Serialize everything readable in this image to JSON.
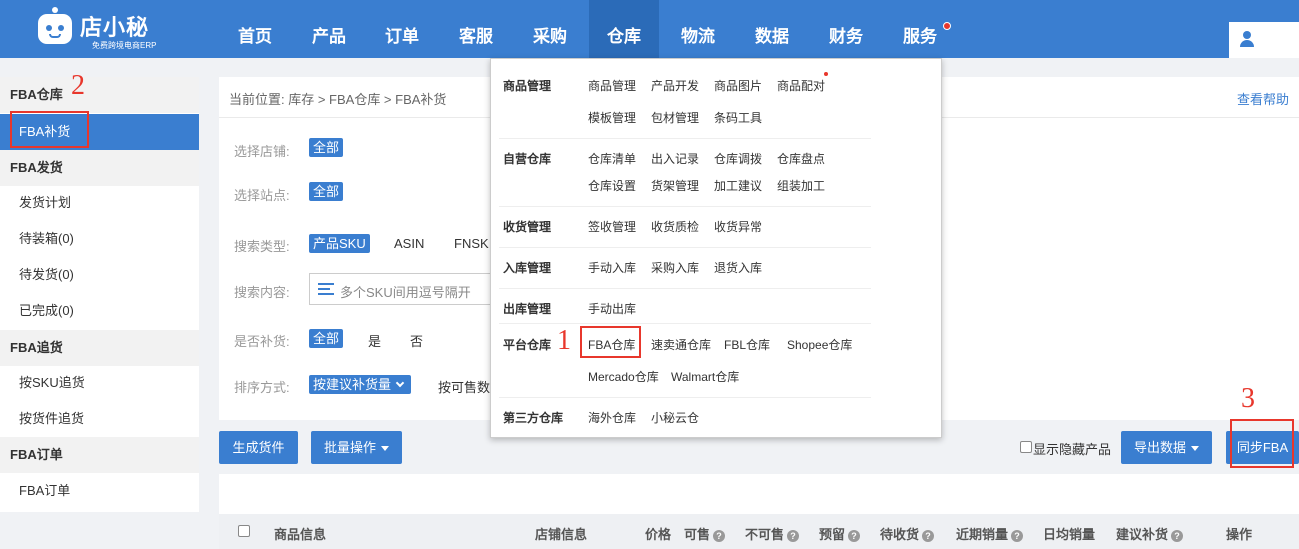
{
  "logo": {
    "title": "店小秘",
    "subtitle": "免费跨境电商ERP"
  },
  "nav": {
    "items": [
      {
        "label": "首页"
      },
      {
        "label": "产品"
      },
      {
        "label": "订单"
      },
      {
        "label": "客服"
      },
      {
        "label": "采购"
      },
      {
        "label": "仓库"
      },
      {
        "label": "物流"
      },
      {
        "label": "数据"
      },
      {
        "label": "财务"
      },
      {
        "label": "服务"
      }
    ],
    "active": "仓库"
  },
  "sidebar": {
    "groups": [
      {
        "label": "FBA仓库",
        "items": [
          {
            "label": "FBA补货"
          }
        ]
      },
      {
        "label": "FBA发货",
        "items": [
          {
            "label": "发货计划"
          },
          {
            "label": "待装箱(0)"
          },
          {
            "label": "待发货(0)"
          },
          {
            "label": "已完成(0)"
          }
        ]
      },
      {
        "label": "FBA追货",
        "items": [
          {
            "label": "按SKU追货"
          },
          {
            "label": "按货件追货"
          }
        ]
      },
      {
        "label": "FBA订单",
        "items": [
          {
            "label": "FBA订单"
          }
        ]
      }
    ],
    "active": "FBA补货"
  },
  "breadcrumb": "当前位置:  库存 > FBA仓库 > FBA补货",
  "help_link": "查看帮助",
  "filters": {
    "store": {
      "label": "选择店铺:",
      "value": "全部"
    },
    "site": {
      "label": "选择站点:",
      "value": "全部"
    },
    "search_type": {
      "label": "搜索类型:",
      "selected": "产品SKU",
      "options": [
        "ASIN",
        "FNSK"
      ]
    },
    "search_content": {
      "label": "搜索内容:",
      "placeholder": "多个SKU间用逗号隔开"
    },
    "replenish": {
      "label": "是否补货:",
      "selected": "全部",
      "options": [
        "是",
        "否"
      ]
    },
    "sort": {
      "label": "排序方式:",
      "selected": "按建议补货量",
      "options": [
        "按可售数"
      ]
    }
  },
  "toolbar": {
    "generate": "生成货件",
    "batch": "批量操作",
    "show_hidden": "显示隐藏产品",
    "export": "导出数据",
    "sync": "同步FBA"
  },
  "table": {
    "headers": [
      "商品信息",
      "店铺信息",
      "价格",
      "可售",
      "不可售",
      "预留",
      "待收货",
      "近期销量",
      "日均销量",
      "建议补货",
      "操作"
    ]
  },
  "dropdown": {
    "sections": [
      {
        "title": "商品管理",
        "links": [
          "商品管理",
          "产品开发",
          "商品图片",
          "商品配对",
          "模板管理",
          "包材管理",
          "条码工具"
        ]
      },
      {
        "title": "自营仓库",
        "links": [
          "仓库清单",
          "出入记录",
          "仓库调拨",
          "仓库盘点",
          "仓库设置",
          "货架管理",
          "加工建议",
          "组装加工"
        ]
      },
      {
        "title": "收货管理",
        "links": [
          "签收管理",
          "收货质检",
          "收货异常"
        ]
      },
      {
        "title": "入库管理",
        "links": [
          "手动入库",
          "采购入库",
          "退货入库"
        ]
      },
      {
        "title": "出库管理",
        "links": [
          "手动出库"
        ]
      },
      {
        "title": "平台仓库",
        "links": [
          "FBA仓库",
          "速卖通仓库",
          "FBL仓库",
          "Shopee仓库",
          "Mercado仓库",
          "Walmart仓库"
        ]
      },
      {
        "title": "第三方仓库",
        "links": [
          "海外仓库",
          "小秘云仓"
        ]
      }
    ]
  },
  "annotations": [
    "1",
    "2",
    "3"
  ],
  "colors": {
    "primary": "#3a7ed0",
    "nav_active": "#2b6bb8",
    "annotation": "#e8372c"
  }
}
